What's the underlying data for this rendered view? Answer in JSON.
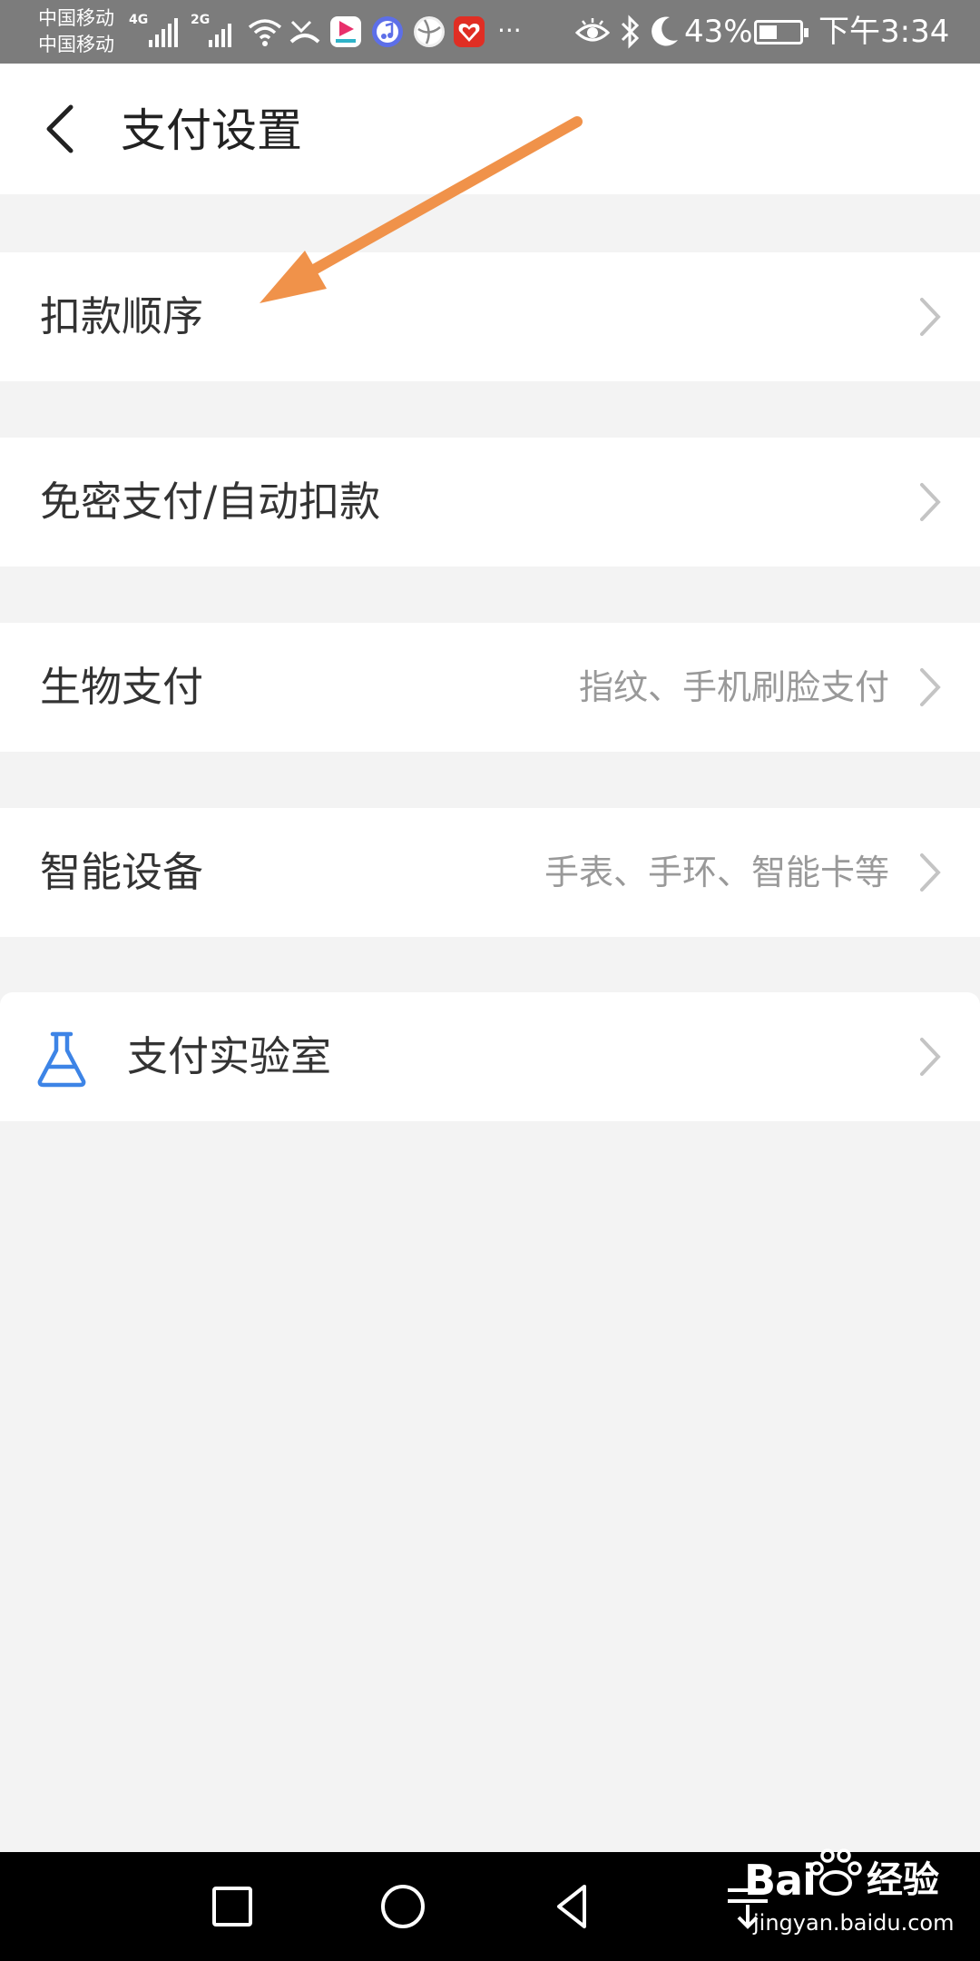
{
  "status_bar": {
    "carrier_1": "中国移动",
    "carrier_2": "中国移动",
    "network_1": "4G",
    "network_2": "2G",
    "battery": "43%",
    "time": "下午3:34",
    "more": "···"
  },
  "header": {
    "title": "支付设置"
  },
  "settings": [
    {
      "label": "扣款顺序",
      "desc": ""
    },
    {
      "label": "免密支付/自动扣款",
      "desc": ""
    },
    {
      "label": "生物支付",
      "desc": "指纹、手机刷脸支付"
    },
    {
      "label": "智能设备",
      "desc": "手表、手环、智能卡等"
    }
  ],
  "lab": {
    "label": "支付实验室",
    "icon": "flask-icon"
  },
  "watermark": {
    "brand": "Bai",
    "brand_cn": "经验",
    "url": "jingyan.baidu.com"
  },
  "colors": {
    "accent_arrow": "#f0924a",
    "flask_icon": "#3d84e6",
    "status_bar": "#7c7c7c"
  }
}
